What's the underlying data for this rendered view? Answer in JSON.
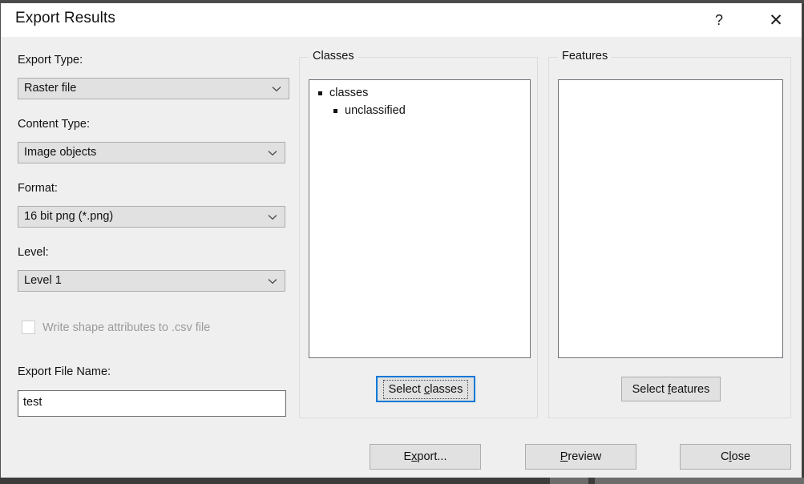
{
  "window": {
    "title": "Export Results",
    "help_label": "?",
    "close_label": "✕"
  },
  "left_panel": {
    "export_type": {
      "label": "Export Type:",
      "value": "Raster file"
    },
    "content_type": {
      "label": "Content Type:",
      "value": "Image objects"
    },
    "format": {
      "label": "Format:",
      "value": "16 bit png (*.png)"
    },
    "level": {
      "label": "Level:",
      "value": "Level 1"
    },
    "write_shape_attributes": {
      "label": "Write shape attributes to .csv file",
      "checked": false,
      "enabled": false
    },
    "export_file_name": {
      "label": "Export File Name:",
      "value": "test",
      "placeholder": ""
    }
  },
  "classes_group": {
    "title": "Classes",
    "tree": [
      {
        "label": "classes",
        "level": 0
      },
      {
        "label": "unclassified",
        "level": 1
      }
    ],
    "select_button": {
      "prefix": "Select ",
      "accel": "c",
      "suffix": "lasses",
      "full_label": "Select classes",
      "focused": true
    }
  },
  "features_group": {
    "title": "Features",
    "items": [],
    "select_button": {
      "prefix": "Select ",
      "accel": "f",
      "suffix": "eatures",
      "full_label": "Select features",
      "focused": false
    }
  },
  "footer": {
    "export": {
      "prefix": "E",
      "accel": "x",
      "suffix": "port...",
      "full_label": "Export..."
    },
    "preview": {
      "prefix": "",
      "accel": "P",
      "suffix": "review",
      "full_label": "Preview"
    },
    "close": {
      "prefix": "C",
      "accel": "l",
      "suffix": "ose",
      "full_label": "Close"
    }
  },
  "colors": {
    "dialog_background": "#efefef",
    "titlebar_background": "#ffffff",
    "control_fill": "#e1e1e1",
    "control_border": "#adadad",
    "focus_accent": "#0078d7",
    "listbox_border": "#6d7278",
    "disabled_text": "#9a9a9a",
    "text": "#111111"
  }
}
